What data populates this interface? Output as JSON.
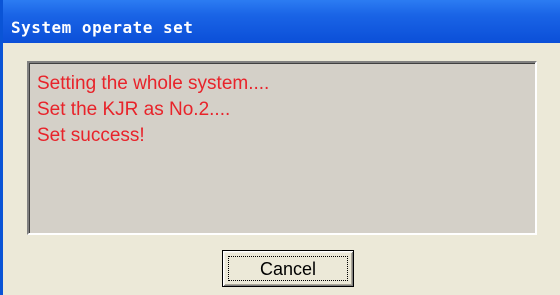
{
  "window": {
    "title": "System operate set"
  },
  "messages": [
    "Setting the whole system....",
    "Set the KJR as No.2....",
    "Set success!"
  ],
  "buttons": {
    "cancel_label": "Cancel"
  },
  "colors": {
    "titlebar": "#0b4fd8",
    "message_text": "#e8232a",
    "dialog_background": "#ece9d8",
    "message_background": "#d4d0c8"
  }
}
